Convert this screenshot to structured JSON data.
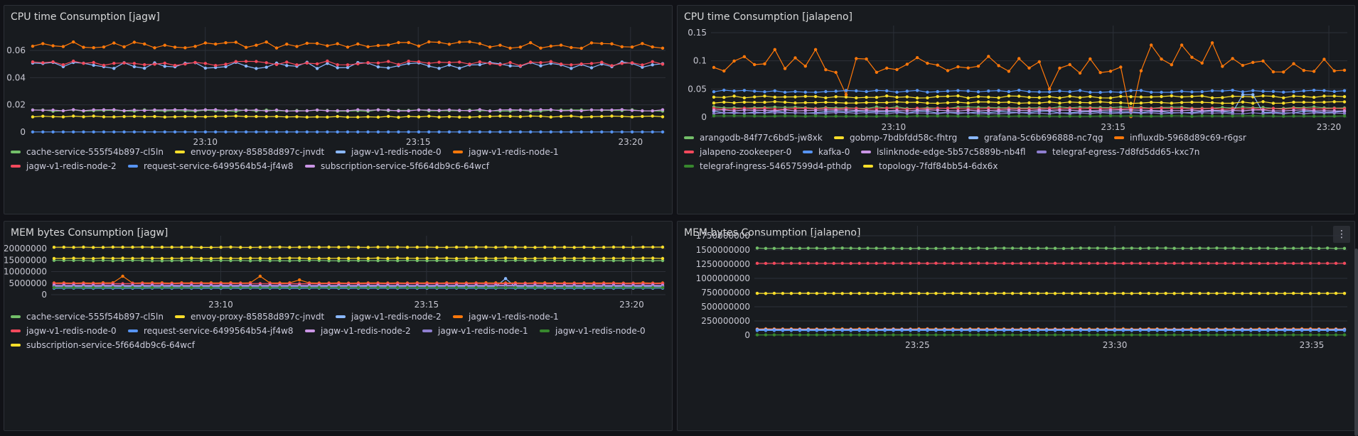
{
  "colors": {
    "green": "#73bf69",
    "yellow": "#fade2a",
    "lightblue": "#8ab8ff",
    "orange": "#ff780a",
    "red": "#f2495c",
    "blue": "#5794f2",
    "purple": "#ca95e5",
    "violet": "#8f7fd0",
    "darkgreen": "#37872d"
  },
  "panels": {
    "cpu_jagw": {
      "title": "CPU time Consumption [jagw]"
    },
    "cpu_jalapeno": {
      "title": "CPU time Consumption [jalapeno]"
    },
    "mem_jagw": {
      "title": "MEM bytes Consumption [jagw]"
    },
    "mem_jalapeno": {
      "title": "MEM bytes Consumption [jalapeno]",
      "menu_icon": "kebab-menu-icon"
    }
  },
  "chart_data": [
    {
      "type": "line",
      "title": "CPU time Consumption [jagw]",
      "x_ticks": [
        "23:10",
        "23:15",
        "23:20"
      ],
      "x_tick_pos": [
        0.276,
        0.611,
        0.945
      ],
      "y_ticks": [
        "0",
        "0.02",
        "0.04",
        "0.06"
      ],
      "ylim": [
        0,
        0.072
      ],
      "grid": true,
      "legend_placement": "bottom",
      "points": 63,
      "series": [
        {
          "name": "cache-service-555f54b897-cl5ln",
          "color": "#73bf69",
          "base": 0.0158,
          "noise": 0.0006
        },
        {
          "name": "envoy-proxy-85858d897c-jnvdt",
          "color": "#fade2a",
          "base": 0.0113,
          "noise": 0.0005
        },
        {
          "name": "jagw-v1-redis-node-0",
          "color": "#8ab8ff",
          "base": 0.049,
          "noise": 0.0025
        },
        {
          "name": "jagw-v1-redis-node-1",
          "color": "#ff780a",
          "base": 0.064,
          "noise": 0.0025
        },
        {
          "name": "jagw-v1-redis-node-2",
          "color": "#f2495c",
          "base": 0.0505,
          "noise": 0.0018
        },
        {
          "name": "request-service-6499564b54-jf4w8",
          "color": "#5794f2",
          "base": 0.0001,
          "noise": 0.0
        },
        {
          "name": "subscription-service-5f664db9c6-64wcf",
          "color": "#ca95e5",
          "base": 0.016,
          "noise": 0.0005
        }
      ]
    },
    {
      "type": "line",
      "title": "CPU time Consumption [jalapeno]",
      "x_ticks": [
        "23:10",
        "23:15",
        "23:20"
      ],
      "x_tick_pos": [
        0.287,
        0.632,
        0.971
      ],
      "y_ticks": [
        "0",
        "0.05",
        "0.1",
        "0.15"
      ],
      "ylim": [
        0,
        0.15
      ],
      "grid": true,
      "legend_placement": "bottom",
      "points": 63,
      "series": [
        {
          "name": "arangodb-84f77c6bd5-jw8xk",
          "color": "#73bf69",
          "base": 0.017,
          "noise": 0.0015
        },
        {
          "name": "gobmp-7bdbfdd58c-fhtrg",
          "color": "#fade2a",
          "base": 0.036,
          "noise": 0.002
        },
        {
          "name": "grafana-5c6b696888-nc7qg",
          "color": "#8ab8ff",
          "base": 0.009,
          "noise": 0.002
        },
        {
          "name": "influxdb-5968d89c69-r6gsr",
          "color": "#ff780a",
          "base": 0.093,
          "noise": 0.015
        },
        {
          "name": "jalapeno-zookeeper-0",
          "color": "#f2495c",
          "base": 0.015,
          "noise": 0.001
        },
        {
          "name": "kafka-0",
          "color": "#5794f2",
          "base": 0.046,
          "noise": 0.002
        },
        {
          "name": "lslinknode-edge-5b57c5889b-nb4fl",
          "color": "#ca95e5",
          "base": 0.012,
          "noise": 0.001
        },
        {
          "name": "telegraf-egress-7d8fd5dd65-kxc7n",
          "color": "#8f7fd0",
          "base": 0.007,
          "noise": 0.001
        },
        {
          "name": "telegraf-ingress-54657599d4-pthdp",
          "color": "#37872d",
          "base": 0.002,
          "noise": 0.0005
        },
        {
          "name": "topology-7fdf84bb54-6dx6x",
          "color": "#fade2a",
          "base": 0.026,
          "noise": 0.0015
        }
      ]
    },
    {
      "type": "line",
      "title": "MEM bytes Consumption [jagw]",
      "x_ticks": [
        "23:10",
        "23:15",
        "23:20"
      ],
      "x_tick_pos": [
        0.276,
        0.611,
        0.945
      ],
      "y_ticks": [
        "0",
        "5000000",
        "10000000",
        "15000000",
        "20000000"
      ],
      "ylim": [
        0,
        22500000
      ],
      "grid": true,
      "legend_placement": "bottom",
      "points": 63,
      "series": [
        {
          "name": "cache-service-555f54b897-cl5ln",
          "color": "#73bf69",
          "base": 14800000,
          "noise": 100000
        },
        {
          "name": "envoy-proxy-85858d897c-jnvdt",
          "color": "#fade2a",
          "base": 20600000,
          "noise": 80000
        },
        {
          "name": "jagw-v1-redis-node-2",
          "color": "#8ab8ff",
          "base": 3500000,
          "noise": 60000
        },
        {
          "name": "jagw-v1-redis-node-1",
          "color": "#ff780a",
          "base": 5100000,
          "noise": 80000
        },
        {
          "name": "jagw-v1-redis-node-0",
          "color": "#f2495c",
          "base": 4800000,
          "noise": 60000
        },
        {
          "name": "request-service-6499564b54-jf4w8",
          "color": "#5794f2",
          "base": 2800000,
          "noise": 30000
        },
        {
          "name": "jagw-v1-redis-node-2",
          "color": "#ca95e5",
          "base": 4100000,
          "noise": 40000
        },
        {
          "name": "jagw-v1-redis-node-1",
          "color": "#8f7fd0",
          "base": 3700000,
          "noise": 40000
        },
        {
          "name": "jagw-v1-redis-node-0",
          "color": "#37872d",
          "base": 3100000,
          "noise": 30000
        },
        {
          "name": "subscription-service-5f664db9c6-64wcf",
          "color": "#fade2a",
          "base": 15800000,
          "noise": 100000
        }
      ]
    },
    {
      "type": "line",
      "title": "MEM bytes Consumption [jalapeno]",
      "x_ticks": [
        "23:25",
        "23:30",
        "23:35"
      ],
      "x_tick_pos": [
        0.275,
        0.608,
        0.94
      ],
      "y_ticks": [
        "0",
        "250000000",
        "500000000",
        "750000000",
        "1000000000",
        "1250000000",
        "1500000000",
        "1750000000"
      ],
      "ylim": [
        0,
        1800000000
      ],
      "grid": true,
      "legend_placement": "none",
      "points": 70,
      "series": [
        {
          "color": "#73bf69",
          "base": 1530000000,
          "noise": 4000000
        },
        {
          "color": "#f2495c",
          "base": 1265000000,
          "noise": 1000000
        },
        {
          "color": "#fade2a",
          "base": 735000000,
          "noise": 1000000
        },
        {
          "color": "#ff780a",
          "base": 110000000,
          "noise": 3000000
        },
        {
          "color": "#ca95e5",
          "base": 100000000,
          "noise": 2000000
        },
        {
          "color": "#8ab8ff",
          "base": 95000000,
          "noise": 2000000
        },
        {
          "color": "#5794f2",
          "base": 82000000,
          "noise": 1000000
        },
        {
          "color": "#37872d",
          "base": 5000000,
          "noise": 500000
        }
      ]
    }
  ]
}
